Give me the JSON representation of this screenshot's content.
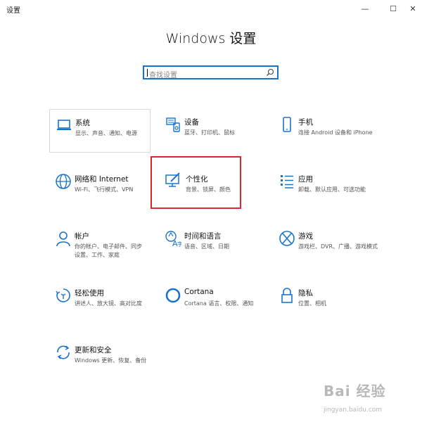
{
  "window": {
    "title": "设置",
    "controls": [
      "—",
      "☐",
      "✕"
    ]
  },
  "heading": "Windows 设置",
  "search": {
    "placeholder": "查找设置"
  },
  "tiles": [
    {
      "name": "系统",
      "desc": "显示、声音、通知、电源",
      "icon": "laptop-icon"
    },
    {
      "name": "设备",
      "desc": "蓝牙、打印机、鼠标",
      "icon": "keyboard-speaker-icon"
    },
    {
      "name": "手机",
      "desc": "连接 Android 设备和 iPhone",
      "icon": "phone-icon"
    },
    {
      "name": "网络和 Internet",
      "desc": "Wi-Fi、飞行模式、VPN",
      "icon": "globe-icon"
    },
    {
      "name": "个性化",
      "desc": "背景、锁屏、颜色",
      "icon": "paint-monitor-icon"
    },
    {
      "name": "应用",
      "desc": "卸载、默认应用、可选功能",
      "icon": "apps-list-icon"
    },
    {
      "name": "帐户",
      "desc": "你的帐户、电子邮件、同步设置、工作、家庭",
      "icon": "person-icon"
    },
    {
      "name": "时间和语言",
      "desc": "语音、区域、日期",
      "icon": "time-language-icon"
    },
    {
      "name": "游戏",
      "desc": "游戏栏、DVR、广播、游戏模式",
      "icon": "xbox-icon"
    },
    {
      "name": "轻松使用",
      "desc": "讲述人、放大镜、高对比度",
      "icon": "ease-of-access-icon"
    },
    {
      "name": "Cortana",
      "desc": "Cortana 语言、权限、通知",
      "icon": "cortana-icon"
    },
    {
      "name": "隐私",
      "desc": "位置、相机",
      "icon": "lock-icon"
    },
    {
      "name": "更新和安全",
      "desc": "Windows 更新、恢复、备份",
      "icon": "update-icon"
    }
  ],
  "watermark": {
    "logo": "Bai 经验",
    "url": "jingyan.baidu.com"
  },
  "colors": {
    "accent": "#1a73c9",
    "highlight": "#e0262b"
  }
}
